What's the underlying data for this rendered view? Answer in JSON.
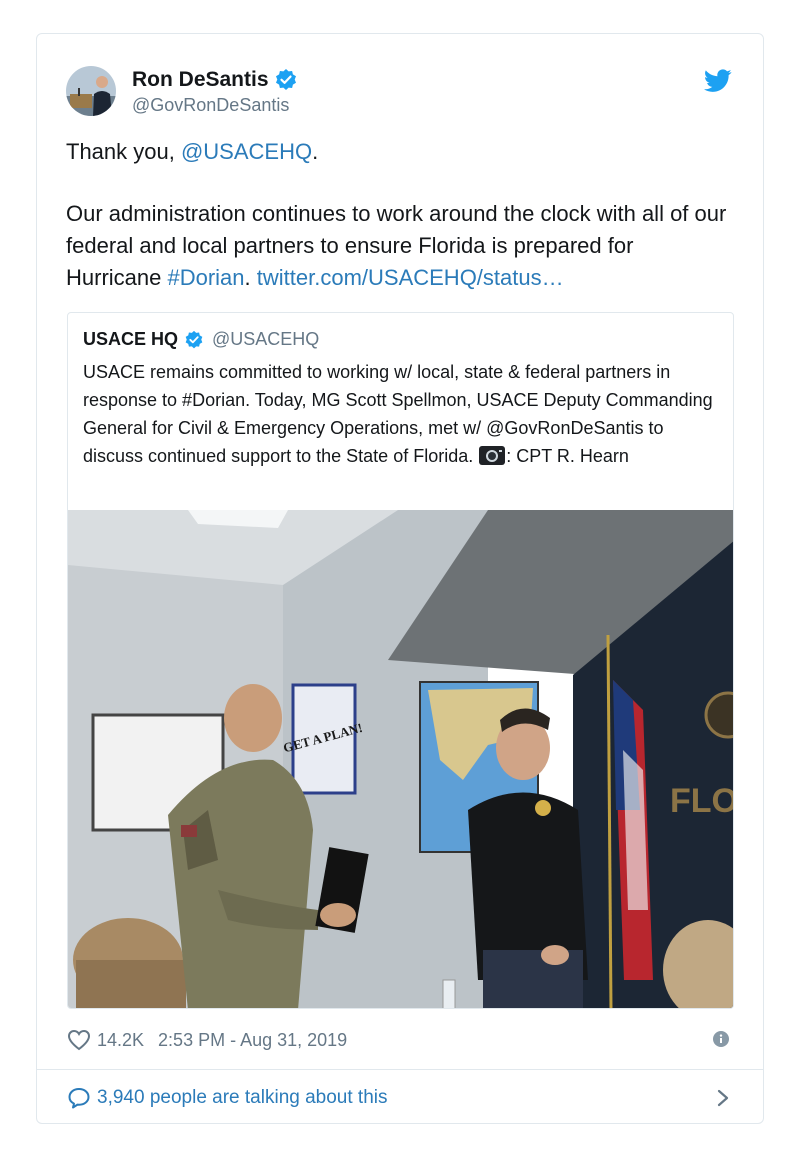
{
  "tweet": {
    "display_name": "Ron DeSantis",
    "handle": "@GovRonDeSantis",
    "verified": true,
    "text_line1_prefix": "Thank you, ",
    "text_line1_mention": "@USACEHQ",
    "text_line1_suffix": ".",
    "text_body": "Our administration continues to work around the clock with all of our federal and local partners to ensure Florida is prepared for Hurricane ",
    "text_hashtag": "#Dorian",
    "text_after_hashtag": ". ",
    "text_link": "twitter.com/USACEHQ/status…",
    "likes": "14.2K",
    "timestamp": "2:53 PM - Aug 31, 2019",
    "talking": "3,940 people are talking about this"
  },
  "quoted": {
    "display_name": "USACE HQ",
    "handle": "@USACEHQ",
    "verified": true,
    "text": "USACE remains committed to working w/ local, state & federal partners in response to #Dorian. Today, MG Scott Spellmon, USACE Deputy Commanding General for Civil & Emergency Operations, met w/ @GovRonDeSantis to discuss continued support to the State of Florida. ",
    "text_after_camera": ": CPT R. Hearn",
    "photo": {
      "poster_text": "GET A PLAN!",
      "wall_text": "FLO"
    }
  },
  "icons": {
    "verified": "verified-badge-icon",
    "brand": "twitter-bird-icon",
    "like": "heart-icon",
    "info": "info-icon",
    "reply": "speech-bubble-icon",
    "chevron": "chevron-right-icon",
    "camera": "camera-emoji-icon"
  },
  "colors": {
    "link": "#2b7bb9",
    "verified": "#1da1f2",
    "secondary_text": "#657786",
    "border": "#e1e8ed"
  }
}
